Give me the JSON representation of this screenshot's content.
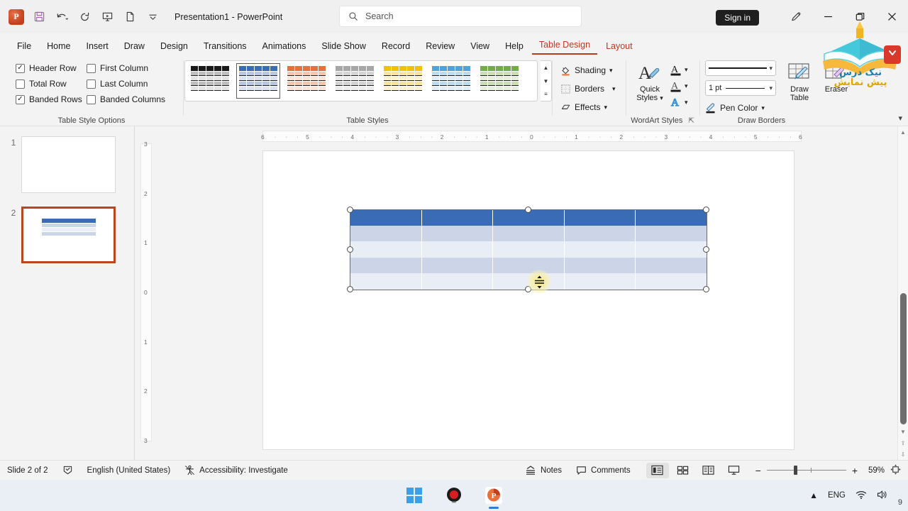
{
  "titlebar": {
    "app_icon": "powerpoint-icon",
    "document_title": "Presentation1  -  PowerPoint",
    "qat": [
      {
        "name": "save-icon",
        "glyph": "💾"
      },
      {
        "name": "undo-icon",
        "glyph": "↶"
      },
      {
        "name": "redo-icon",
        "glyph": "↻"
      },
      {
        "name": "start-presentation-icon",
        "glyph": "⬚"
      },
      {
        "name": "new-slide-icon",
        "glyph": "▭"
      },
      {
        "name": "customize-qat-icon",
        "glyph": "⌄"
      }
    ],
    "signin_label": "Sign in",
    "window": {
      "minimize": "—",
      "restore": "❐",
      "close": "✕"
    }
  },
  "search": {
    "placeholder": "Search",
    "icon": "search-icon"
  },
  "tabs": [
    {
      "label": "File",
      "state": "normal"
    },
    {
      "label": "Home",
      "state": "normal"
    },
    {
      "label": "Insert",
      "state": "normal"
    },
    {
      "label": "Draw",
      "state": "normal"
    },
    {
      "label": "Design",
      "state": "normal"
    },
    {
      "label": "Transitions",
      "state": "normal"
    },
    {
      "label": "Animations",
      "state": "normal"
    },
    {
      "label": "Slide Show",
      "state": "normal"
    },
    {
      "label": "Record",
      "state": "normal"
    },
    {
      "label": "Review",
      "state": "normal"
    },
    {
      "label": "View",
      "state": "normal"
    },
    {
      "label": "Help",
      "state": "normal"
    },
    {
      "label": "Table Design",
      "state": "active"
    },
    {
      "label": "Layout",
      "state": "contextual"
    }
  ],
  "ribbon": {
    "table_style_options": {
      "group_label": "Table Style Options",
      "items": [
        {
          "label": "Header Row",
          "checked": true
        },
        {
          "label": "First Column",
          "checked": false
        },
        {
          "label": "Total Row",
          "checked": false
        },
        {
          "label": "Last Column",
          "checked": false
        },
        {
          "label": "Banded Rows",
          "checked": true
        },
        {
          "label": "Banded Columns",
          "checked": false
        }
      ]
    },
    "table_styles": {
      "group_label": "Table Styles",
      "selected_index": 1,
      "swatches": [
        {
          "name": "style-black",
          "header": "#1a1a1a",
          "band_a": "#bfbfbf",
          "band_b": "#e6e6e6"
        },
        {
          "name": "style-blue",
          "header": "#3a6cb5",
          "band_a": "#b8c8e4",
          "band_b": "#dce4f3"
        },
        {
          "name": "style-orange",
          "header": "#e8703a",
          "band_a": "#f6c7ae",
          "band_b": "#fbe5da"
        },
        {
          "name": "style-gray",
          "header": "#a6a6a6",
          "band_a": "#d4d4d4",
          "band_b": "#ededed"
        },
        {
          "name": "style-yellow",
          "header": "#f2c200",
          "band_a": "#fae49a",
          "band_b": "#fdf3d4"
        },
        {
          "name": "style-lightblue",
          "header": "#4fa3dc",
          "band_a": "#bcdcf2",
          "band_b": "#e0eff9"
        },
        {
          "name": "style-green",
          "header": "#74ab49",
          "band_a": "#cbdfb4",
          "band_b": "#e7f0dc"
        }
      ]
    },
    "shading_group": [
      {
        "label": "Shading",
        "icon": "paint-bucket-icon",
        "dropdown": true
      },
      {
        "label": "Borders",
        "icon": "borders-icon",
        "dropdown": true
      },
      {
        "label": "Effects",
        "icon": "effects-icon",
        "dropdown": true
      }
    ],
    "wordart": {
      "group_label": "WordArt Styles",
      "quick_styles_label": "Quick\nStyles",
      "quick_styles_line1": "Quick",
      "quick_styles_line2": "Styles",
      "buttons": [
        {
          "name": "text-fill-icon",
          "glyph": "A"
        },
        {
          "name": "text-outline-icon",
          "glyph": "A"
        },
        {
          "name": "text-effects-icon",
          "glyph": "A"
        }
      ],
      "dialog_launcher": "⤵"
    },
    "draw_borders": {
      "group_label": "Draw Borders",
      "pen_style_value": "",
      "pen_weight_value": "1 pt",
      "pen_color_label": "Pen Color",
      "draw_table_line1": "Draw",
      "draw_table_line2": "Table",
      "eraser_label": "Eraser"
    },
    "collapse_icon": "chevron-down-icon"
  },
  "thumbnails": [
    {
      "number": "1",
      "selected": false,
      "has_table": false
    },
    {
      "number": "2",
      "selected": true,
      "has_table": true
    }
  ],
  "rulers": {
    "horizontal": [
      "6",
      "5",
      "4",
      "3",
      "2",
      "1",
      "0",
      "1",
      "2",
      "3",
      "4",
      "5",
      "6"
    ],
    "vertical": [
      "3",
      "2",
      "1",
      "0",
      "1",
      "2",
      "3"
    ]
  },
  "slide": {
    "table": {
      "columns": 5,
      "rows": 5,
      "header_color": "#3a6cb5",
      "band_a_color": "#ccd5e8",
      "band_b_color": "#e6eaf5",
      "selected": true,
      "cursor": "row-resize-cursor"
    }
  },
  "statusbar": {
    "slide_counter": "Slide 2 of 2",
    "notes_icon_label": "spelling-icon",
    "language": "English (United States)",
    "accessibility": "Accessibility: Investigate",
    "notes_label": "Notes",
    "comments_label": "Comments",
    "views": [
      {
        "name": "normal-view-icon",
        "active": true
      },
      {
        "name": "slide-sorter-icon",
        "active": false
      },
      {
        "name": "reading-view-icon",
        "active": false
      },
      {
        "name": "slideshow-icon",
        "active": false
      }
    ],
    "zoom_out": "−",
    "zoom_in": "+",
    "zoom_level": "59%",
    "fit_slide_icon": "fit-to-window-icon"
  },
  "taskbar": {
    "items": [
      {
        "name": "windows-start-icon",
        "running": false
      },
      {
        "name": "screen-recorder-icon",
        "running": false
      },
      {
        "name": "powerpoint-taskbar-icon",
        "running": true
      }
    ],
    "tray": {
      "overflow_icon": "chevron-up-icon",
      "language": "ENG",
      "wifi_icon": "wifi-icon",
      "volume_icon": "speaker-icon",
      "badge": "9"
    }
  },
  "watermark": {
    "line1": "نیک درس",
    "line2": "پیش نمایش"
  }
}
